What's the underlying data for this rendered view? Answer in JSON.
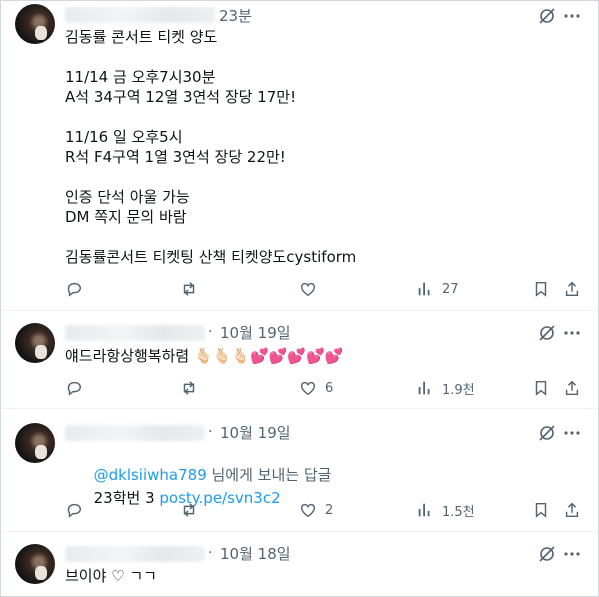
{
  "posts": [
    {
      "time": "23분",
      "lines": [
        "김동률 콘서트 티켓 양도",
        "",
        "11/14 금 오후7시30분",
        "A석 34구역 12열 3연석 장당 17만!",
        "",
        "11/16 일 오후5시",
        "R석 F4구역 1열 3연석 장당 22만!",
        "",
        "인증 단석 아울 가능",
        "DM 쪽지 문의 바람",
        "",
        "김동률콘서트 티켓팅 산책 티켓양도cystiform"
      ],
      "views": "27",
      "replies": "",
      "reposts": "",
      "likes": ""
    },
    {
      "time": "10월 19일",
      "text": "얘드라항상행복하렴 🫰🏻🫰🏻🫰🏻💕💕💕💕💕",
      "likes": "6",
      "views": "1.9천"
    },
    {
      "time": "10월 19일",
      "mention": "@dklsiiwha789",
      "mention_suffix": " 님에게 보내는 답글",
      "body_prefix": "23학번 3 ",
      "link": "posty.pe/svn3c2",
      "likes": "2",
      "views": "1.5천"
    },
    {
      "time": "10월 18일",
      "text": "브이야 ♡ ㄱㄱ"
    }
  ],
  "separator": "·",
  "icons": {
    "reply": "reply-icon",
    "repost": "repost-icon",
    "like": "like-icon",
    "views": "views-icon",
    "bookmark": "bookmark-icon",
    "share": "share-icon",
    "grok": "grok-icon",
    "more": "more-icon"
  },
  "colors": {
    "text": "#0f1419",
    "muted": "#536471",
    "link": "#1d9bf0",
    "border": "#eff3f4"
  }
}
